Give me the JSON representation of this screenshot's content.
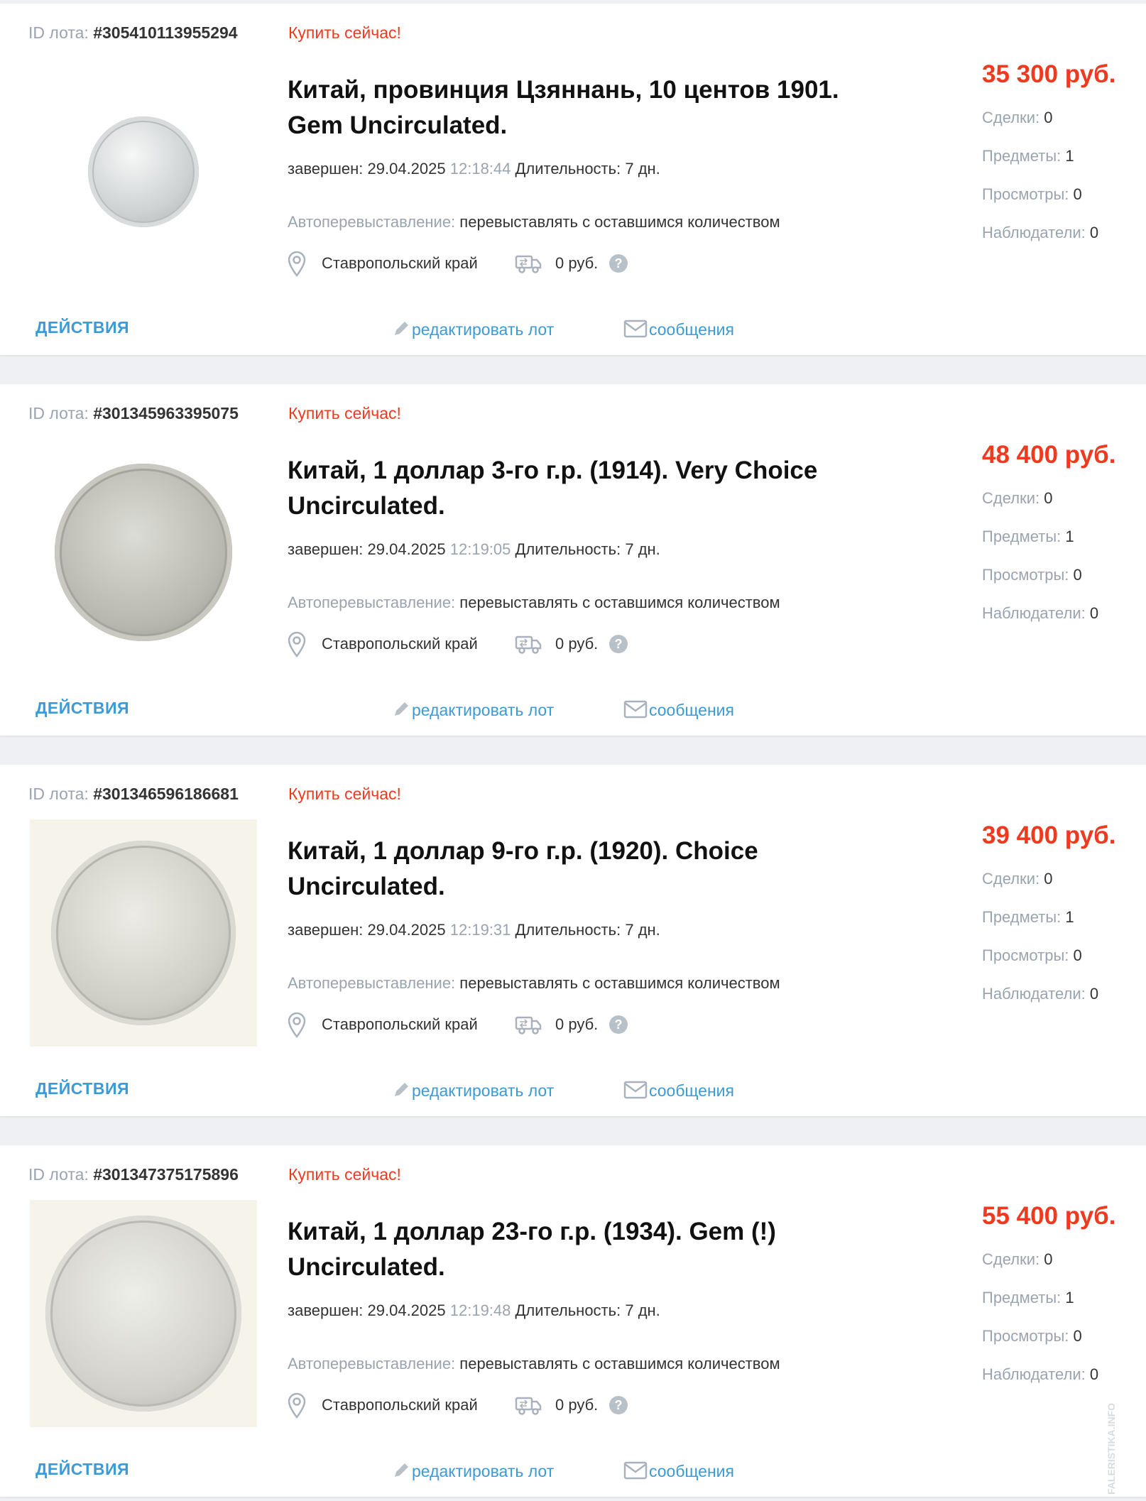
{
  "lots": [
    {
      "id_label": "ID лота:",
      "id": "#305410113955294",
      "buy_now": "Купить сейчас!",
      "title": "Китай, провинция Цзяннань, 10 центов 1901. Gem Uncirculated.",
      "ended_label": "завершен:",
      "ended_date": "29.04.2025",
      "ended_time": "12:18:44",
      "duration_label": "Длительность:",
      "duration": "7 дн.",
      "relist_label": "Автоперевыставление:",
      "relist_value": "перевыставлять с оставшимся количеством",
      "location": "Ставропольский край",
      "shipping": "0 руб.",
      "price": "35 300 руб.",
      "stats": [
        {
          "label": "Сделки:",
          "value": "0"
        },
        {
          "label": "Предметы:",
          "value": "1"
        },
        {
          "label": "Просмотры:",
          "value": "0"
        },
        {
          "label": "Наблюдатели:",
          "value": "0"
        }
      ],
      "actions_label": "ДЕЙСТВИЯ",
      "edit_label": "редактировать лот",
      "messages_label": "сообщения"
    },
    {
      "id_label": "ID лота:",
      "id": "#301345963395075",
      "buy_now": "Купить сейчас!",
      "title": "Китай, 1 доллар 3-го г.р. (1914). Very Choice Uncirculated.",
      "ended_label": "завершен:",
      "ended_date": "29.04.2025",
      "ended_time": "12:19:05",
      "duration_label": "Длительность:",
      "duration": "7 дн.",
      "relist_label": "Автоперевыставление:",
      "relist_value": "перевыставлять с оставшимся количеством",
      "location": "Ставропольский край",
      "shipping": "0 руб.",
      "price": "48 400 руб.",
      "stats": [
        {
          "label": "Сделки:",
          "value": "0"
        },
        {
          "label": "Предметы:",
          "value": "1"
        },
        {
          "label": "Просмотры:",
          "value": "0"
        },
        {
          "label": "Наблюдатели:",
          "value": "0"
        }
      ],
      "actions_label": "ДЕЙСТВИЯ",
      "edit_label": "редактировать лот",
      "messages_label": "сообщения"
    },
    {
      "id_label": "ID лота:",
      "id": "#301346596186681",
      "buy_now": "Купить сейчас!",
      "title": "Китай, 1 доллар 9-го г.р. (1920). Choice Uncirculated.",
      "ended_label": "завершен:",
      "ended_date": "29.04.2025",
      "ended_time": "12:19:31",
      "duration_label": "Длительность:",
      "duration": "7 дн.",
      "relist_label": "Автоперевыставление:",
      "relist_value": "перевыставлять с оставшимся количеством",
      "location": "Ставропольский край",
      "shipping": "0 руб.",
      "price": "39 400 руб.",
      "stats": [
        {
          "label": "Сделки:",
          "value": "0"
        },
        {
          "label": "Предметы:",
          "value": "1"
        },
        {
          "label": "Просмотры:",
          "value": "0"
        },
        {
          "label": "Наблюдатели:",
          "value": "0"
        }
      ],
      "actions_label": "ДЕЙСТВИЯ",
      "edit_label": "редактировать лот",
      "messages_label": "сообщения"
    },
    {
      "id_label": "ID лота:",
      "id": "#301347375175896",
      "buy_now": "Купить сейчас!",
      "title": "Китай, 1 доллар 23-го г.р. (1934). Gem (!) Uncirculated.",
      "ended_label": "завершен:",
      "ended_date": "29.04.2025",
      "ended_time": "12:19:48",
      "duration_label": "Длительность:",
      "duration": "7 дн.",
      "relist_label": "Автоперевыставление:",
      "relist_value": "перевыставлять с оставшимся количеством",
      "location": "Ставропольский край",
      "shipping": "0 руб.",
      "price": "55 400 руб.",
      "stats": [
        {
          "label": "Сделки:",
          "value": "0"
        },
        {
          "label": "Предметы:",
          "value": "1"
        },
        {
          "label": "Просмотры:",
          "value": "0"
        },
        {
          "label": "Наблюдатели:",
          "value": "0"
        }
      ],
      "actions_label": "ДЕЙСТВИЯ",
      "edit_label": "редактировать лот",
      "messages_label": "сообщения"
    }
  ],
  "icons": {
    "location": "map-pin-icon",
    "shipping": "delivery-truck-icon",
    "help": "question-circle-icon",
    "edit": "pencil-icon",
    "messages": "envelope-icon"
  },
  "colors": {
    "accent": "#3c9ad6",
    "price": "#ee3a1e",
    "muted": "#9aa4b0",
    "background": "#eff0f3"
  },
  "watermark": "FALERISTIKA.INFO https://faleristika.info"
}
